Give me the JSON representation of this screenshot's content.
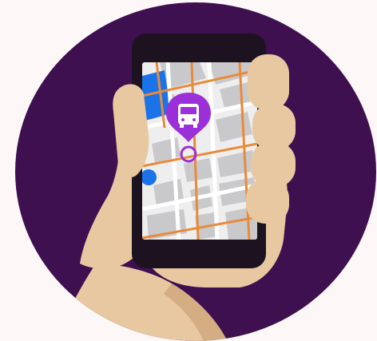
{
  "illustration": {
    "subject": "hand-holding-phone-with-bus-map",
    "icons": [
      "bus-icon",
      "map-pin-icon",
      "location-dot-icon"
    ]
  },
  "colors": {
    "page_background": "#fdf8f7",
    "circle": "#3e1050",
    "skin": "#e8c8a0",
    "skin_shadow": "#d4ad82",
    "phone_body": "#1d1320",
    "map_background": "#eeeeee",
    "map_block": "#c9c9cc",
    "road_white": "#ffffff",
    "road_orange": "#e88a3a",
    "water": "#1a73e8",
    "pin": "#9b30d9",
    "bus_icon": "#ffffff"
  }
}
